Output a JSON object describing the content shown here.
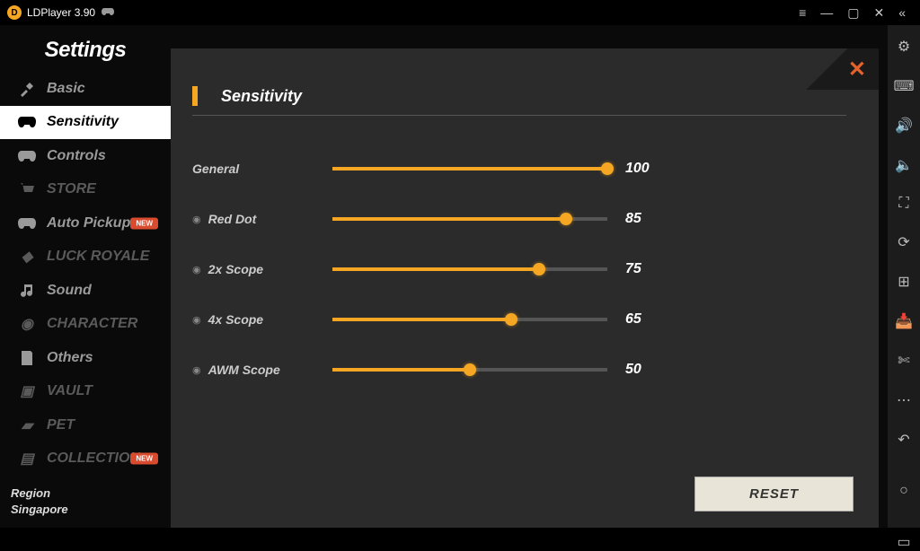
{
  "titlebar": {
    "appname": "LDPlayer 3.90"
  },
  "settings_title": "Settings",
  "nav": {
    "basic": "Basic",
    "sensitivity": "Sensitivity",
    "controls": "Controls",
    "store": "STORE",
    "auto_pickup": "Auto Pickup",
    "luck": "LUCK ROYALE",
    "sound": "Sound",
    "character": "CHARACTER",
    "others": "Others",
    "vault": "VAULT",
    "pet": "PET",
    "collection": "COLLECTION"
  },
  "region": {
    "label": "Region",
    "value": "Singapore"
  },
  "section_title": "Sensitivity",
  "sliders": {
    "general": {
      "label": "General",
      "value": 100,
      "display": "100"
    },
    "red_dot": {
      "label": "Red Dot",
      "value": 85,
      "display": "85"
    },
    "scope_2x": {
      "label": "2x Scope",
      "value": 75,
      "display": "75"
    },
    "scope_4x": {
      "label": "4x Scope",
      "value": 65,
      "display": "65"
    },
    "awm": {
      "label": "AWM Scope",
      "value": 50,
      "display": "50"
    }
  },
  "reset_label": "RESET"
}
